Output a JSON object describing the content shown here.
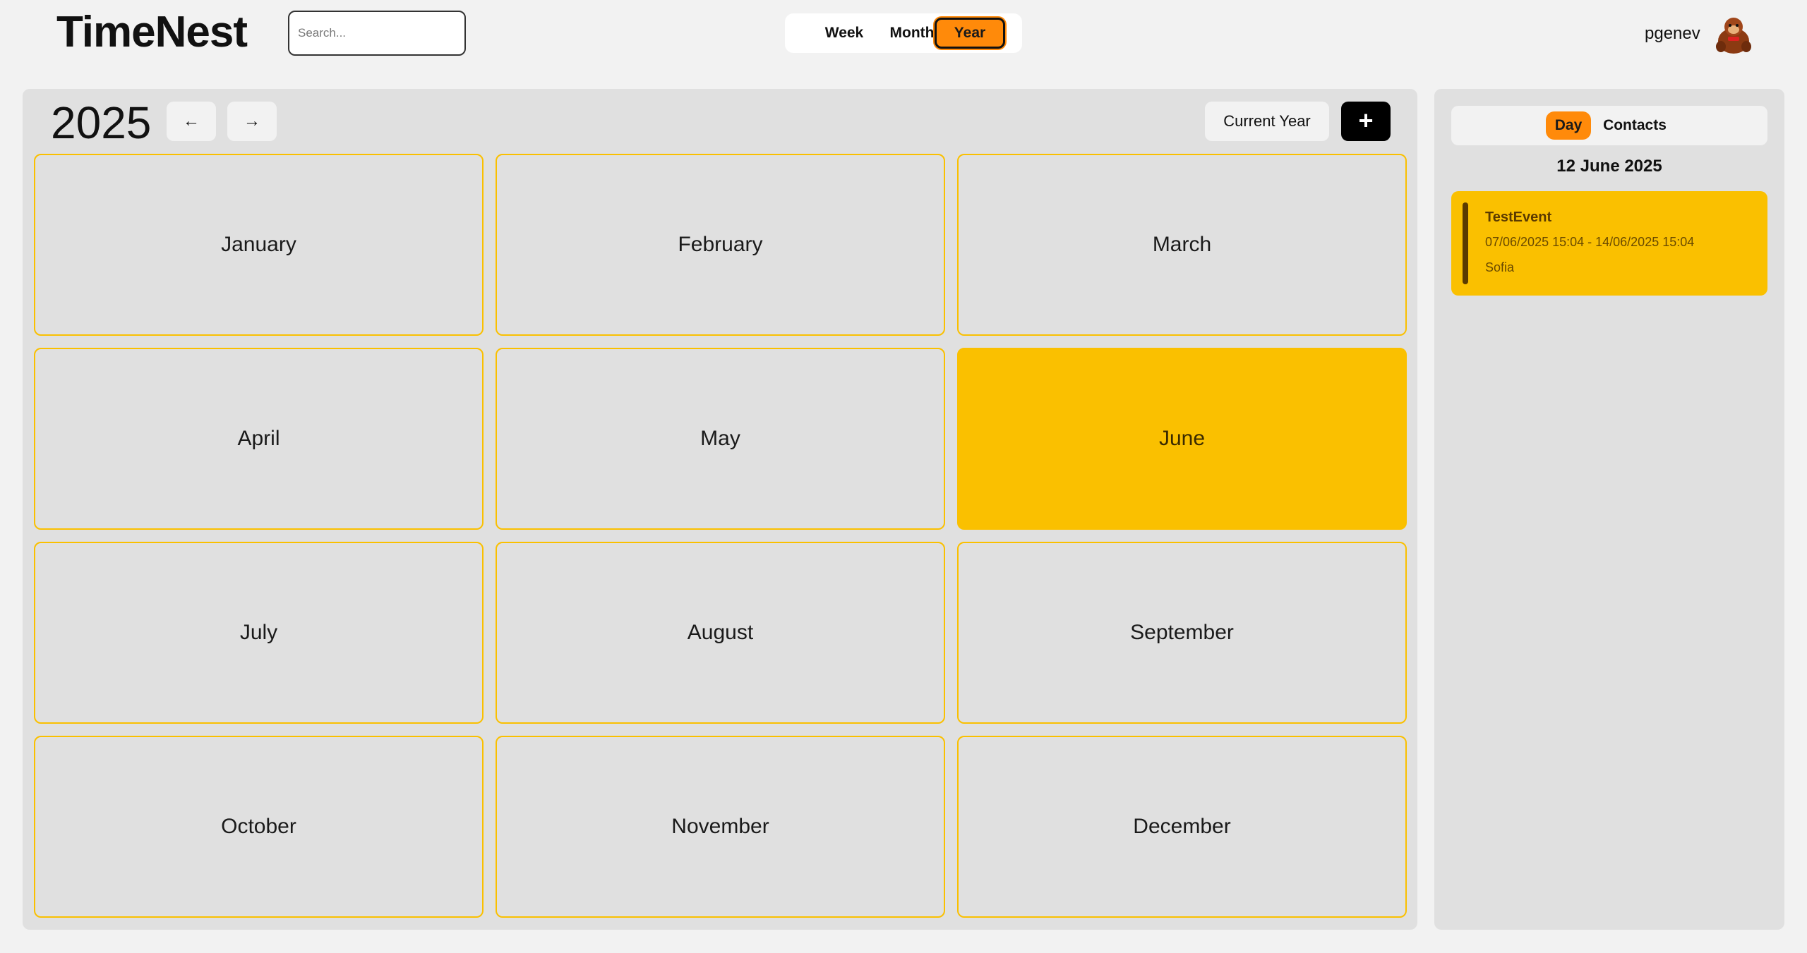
{
  "app": {
    "title": "TimeNest"
  },
  "search": {
    "placeholder": "Search..."
  },
  "view_toggle": {
    "week": "Week",
    "month": "Month",
    "year": "Year",
    "selected": "Year"
  },
  "user": {
    "name": "pgenev",
    "avatar_icon": "gorilla-avatar-icon"
  },
  "calendar": {
    "year": "2025",
    "prev_icon": "arrow-left-icon",
    "prev_glyph": "←",
    "next_icon": "arrow-right-icon",
    "next_glyph": "→",
    "current_year_label": "Current Year",
    "add_glyph": "+",
    "months": [
      "January",
      "February",
      "March",
      "April",
      "May",
      "June",
      "July",
      "August",
      "September",
      "October",
      "November",
      "December"
    ],
    "active_month": "June"
  },
  "side_panel": {
    "tabs": {
      "day": "Day",
      "contacts": "Contacts",
      "selected": "Day"
    },
    "date": "12 June 2025",
    "events": [
      {
        "title": "TestEvent",
        "time": "07/06/2025 15:04 - 14/06/2025 15:04",
        "location": "Sofia"
      }
    ]
  },
  "colors": {
    "accent_orange": "#ff8a0a",
    "accent_yellow": "#fac000",
    "panel_bg": "#e0e0e0",
    "page_bg": "#f2f2f2"
  }
}
